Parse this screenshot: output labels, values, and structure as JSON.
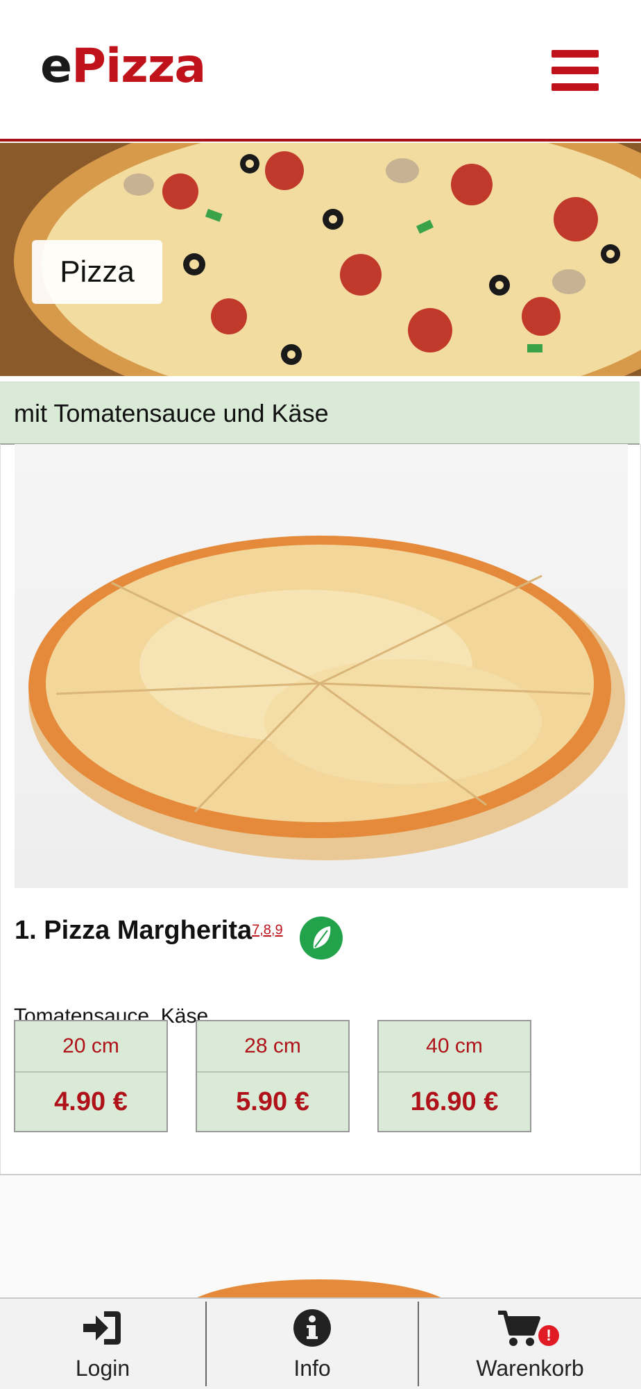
{
  "header": {
    "logo_prefix": "e",
    "logo_main": "Pizza",
    "menu_icon": "hamburger-menu-icon",
    "brand_color": "#c0121a"
  },
  "hero": {
    "category_label": "Pizza"
  },
  "category": {
    "description": "mit Tomatensauce und Käse"
  },
  "product": {
    "name": "1. Pizza Margherita",
    "allergens": "7,8,9",
    "badge_icon": "vegetarian-leaf-icon",
    "description": "Tomatensauce, Käse",
    "prices": [
      {
        "size": "20 cm",
        "price": "4.90 €"
      },
      {
        "size": "28 cm",
        "price": "5.90 €"
      },
      {
        "size": "40 cm",
        "price": "16.90 €"
      }
    ]
  },
  "bottom_nav": {
    "items": [
      {
        "label": "Login",
        "icon": "login-icon"
      },
      {
        "label": "Info",
        "icon": "info-icon"
      },
      {
        "label": "Warenkorb",
        "icon": "cart-icon",
        "badge": "!"
      }
    ]
  }
}
